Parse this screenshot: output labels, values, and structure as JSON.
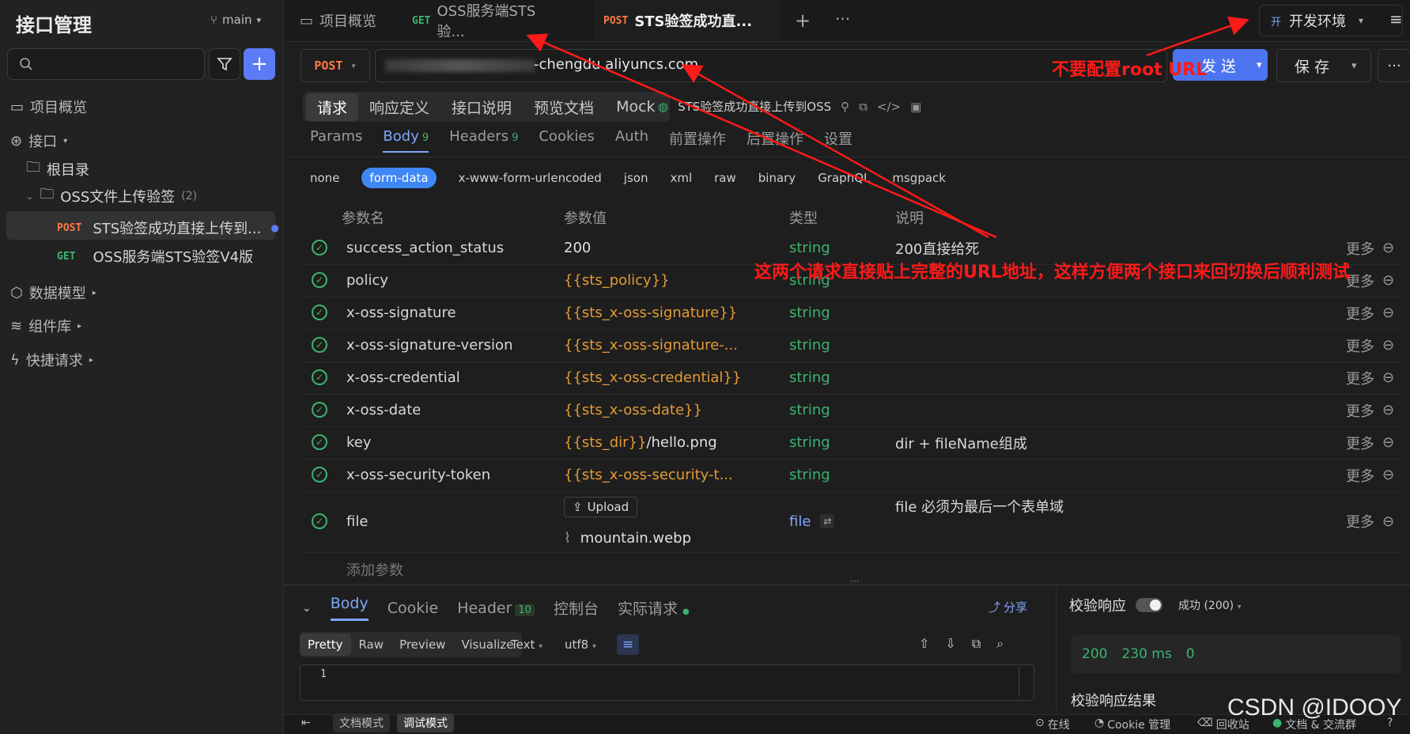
{
  "sidebar": {
    "title": "接口管理",
    "branch": "main",
    "nav": [
      {
        "label": "项目概览"
      },
      {
        "label": "接口"
      },
      {
        "label": "数据模型"
      },
      {
        "label": "组件库"
      },
      {
        "label": "快捷请求"
      }
    ],
    "root_dir": "根目录",
    "folder": {
      "label": "OSS文件上传验签",
      "count": "(2)"
    },
    "items": [
      {
        "method": "POST",
        "label": "STS验签成功直接上传到..."
      },
      {
        "method": "GET",
        "label": "OSS服务端STS验签V4版"
      }
    ]
  },
  "tabs": [
    {
      "label": "项目概览"
    },
    {
      "method": "GET",
      "label": "OSS服务端STS验..."
    },
    {
      "method": "POST",
      "label": "STS验签成功直..."
    }
  ],
  "env": {
    "prefix": "开",
    "label": "开发环境"
  },
  "request": {
    "method": "POST",
    "url_visible": "-chengdu.aliyuncs.com",
    "send_label": "发 送",
    "save_label": "保 存"
  },
  "view_modes": [
    "请求",
    "响应定义",
    "接口说明",
    "预览文档",
    "Mock"
  ],
  "endpoint_label": "STS验签成功直接上传到OSS",
  "sub_tabs": [
    {
      "label": "Params"
    },
    {
      "label": "Body",
      "badge": "9"
    },
    {
      "label": "Headers",
      "badge": "9"
    },
    {
      "label": "Cookies"
    },
    {
      "label": "Auth"
    },
    {
      "label": "前置操作"
    },
    {
      "label": "后置操作"
    },
    {
      "label": "设置"
    }
  ],
  "body_types": [
    "none",
    "form-data",
    "x-www-form-urlencoded",
    "json",
    "xml",
    "raw",
    "binary",
    "GraphQL",
    "msgpack"
  ],
  "params_headers": {
    "name": "参数名",
    "value": "参数值",
    "type": "类型",
    "desc": "说明"
  },
  "params": [
    {
      "name": "success_action_status",
      "value": "200",
      "type": "string",
      "desc": "200直接给死"
    },
    {
      "name": "policy",
      "value": "{{sts_policy}}",
      "type": "string",
      "desc": ""
    },
    {
      "name": "x-oss-signature",
      "value": "{{sts_x-oss-signature}}",
      "type": "string",
      "desc": ""
    },
    {
      "name": "x-oss-signature-version",
      "value": "{{sts_x-oss-signature-...",
      "type": "string",
      "desc": ""
    },
    {
      "name": "x-oss-credential",
      "value": "{{sts_x-oss-credential}}",
      "type": "string",
      "desc": ""
    },
    {
      "name": "x-oss-date",
      "value": "{{sts_x-oss-date}}",
      "type": "string",
      "desc": ""
    },
    {
      "name": "key",
      "value_var": "{{sts_dir}}",
      "value_rest": "/hello.png",
      "type": "string",
      "desc": "dir + fileName组成"
    },
    {
      "name": "x-oss-security-token",
      "value": "{{sts_x-oss-security-t...",
      "type": "string",
      "desc": ""
    }
  ],
  "file_param": {
    "name": "file",
    "upload_label": "Upload",
    "file_name": "mountain.webp",
    "type": "file",
    "desc": "file 必须为最后一个表单域"
  },
  "more_label": "更多",
  "add_param": "添加参数",
  "response": {
    "tabs": [
      {
        "label": "Body"
      },
      {
        "label": "Cookie"
      },
      {
        "label": "Header",
        "badge": "10"
      },
      {
        "label": "控制台"
      },
      {
        "label": "实际请求"
      }
    ],
    "share": "分享",
    "view": [
      "Pretty",
      "Raw",
      "Preview",
      "Visualize"
    ],
    "format": "Text",
    "encoding": "utf8",
    "line_no": "1"
  },
  "validation": {
    "label": "校验响应",
    "status_select": "成功 (200)",
    "code": "200",
    "time": "230 ms",
    "size": "0",
    "result_label": "校验响应结果"
  },
  "footer": {
    "modes": [
      "文档模式",
      "调试模式"
    ],
    "right": [
      "在线",
      "Cookie 管理",
      "回收站",
      "文档 & 交流群"
    ]
  },
  "annotations": {
    "no_root_url": "不要配置root URL",
    "note": "这两个请求直接贴上完整的URL地址，这样方便两个接口来回切换后顺利测试"
  },
  "watermark": "CSDN @IDOOY",
  "colors": {
    "accent": "#5b7cf6",
    "post": "#ff7a45",
    "get": "#3cb371",
    "variable": "#e49b35",
    "annotation": "#ff1a1a"
  }
}
